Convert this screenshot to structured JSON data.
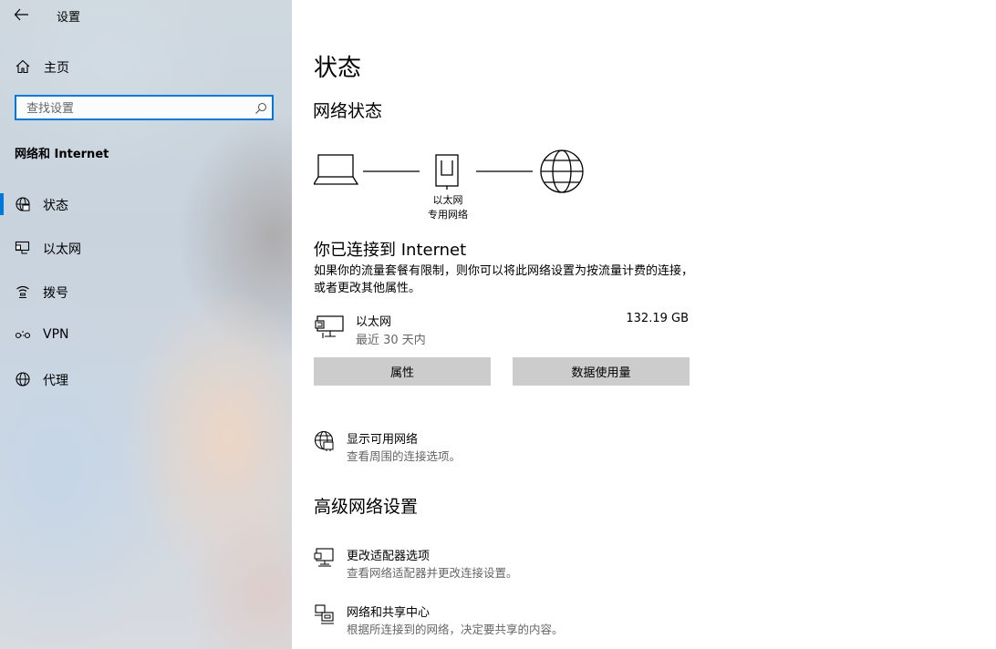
{
  "window": {
    "title": "设置"
  },
  "sidebar": {
    "home_label": "主页",
    "search": {
      "placeholder": "查找设置",
      "value": ""
    },
    "section": "网络和 Internet",
    "items": [
      {
        "label": "状态",
        "icon": "globe-status-icon",
        "selected": true
      },
      {
        "label": "以太网",
        "icon": "ethernet-icon",
        "selected": false
      },
      {
        "label": "拨号",
        "icon": "dialup-icon",
        "selected": false
      },
      {
        "label": "VPN",
        "icon": "vpn-icon",
        "selected": false
      },
      {
        "label": "代理",
        "icon": "globe-icon",
        "selected": false
      }
    ]
  },
  "main": {
    "title": "状态",
    "network_status_heading": "网络状态",
    "diagram": {
      "adapter_name": "以太网",
      "network_type": "专用网络"
    },
    "connected_heading": "你已连接到 Internet",
    "description": "如果你的流量套餐有限制，则你可以将此网络设置为按流量计费的连接，或者更改其他属性。",
    "adapter": {
      "name": "以太网",
      "period": "最近 30 天内",
      "usage": "132.19 GB"
    },
    "buttons": {
      "properties": "属性",
      "data_usage": "数据使用量"
    },
    "show_networks": {
      "title": "显示可用网络",
      "subtitle": "查看周围的连接选项。"
    },
    "advanced_heading": "高级网络设置",
    "advanced": [
      {
        "title": "更改适配器选项",
        "subtitle": "查看网络适配器并更改连接设置。"
      },
      {
        "title": "网络和共享中心",
        "subtitle": "根据所连接到的网络，决定要共享的内容。"
      }
    ]
  },
  "colors": {
    "accent": "#0078d7",
    "button": "#cccccc",
    "secondary_text": "#666666"
  }
}
